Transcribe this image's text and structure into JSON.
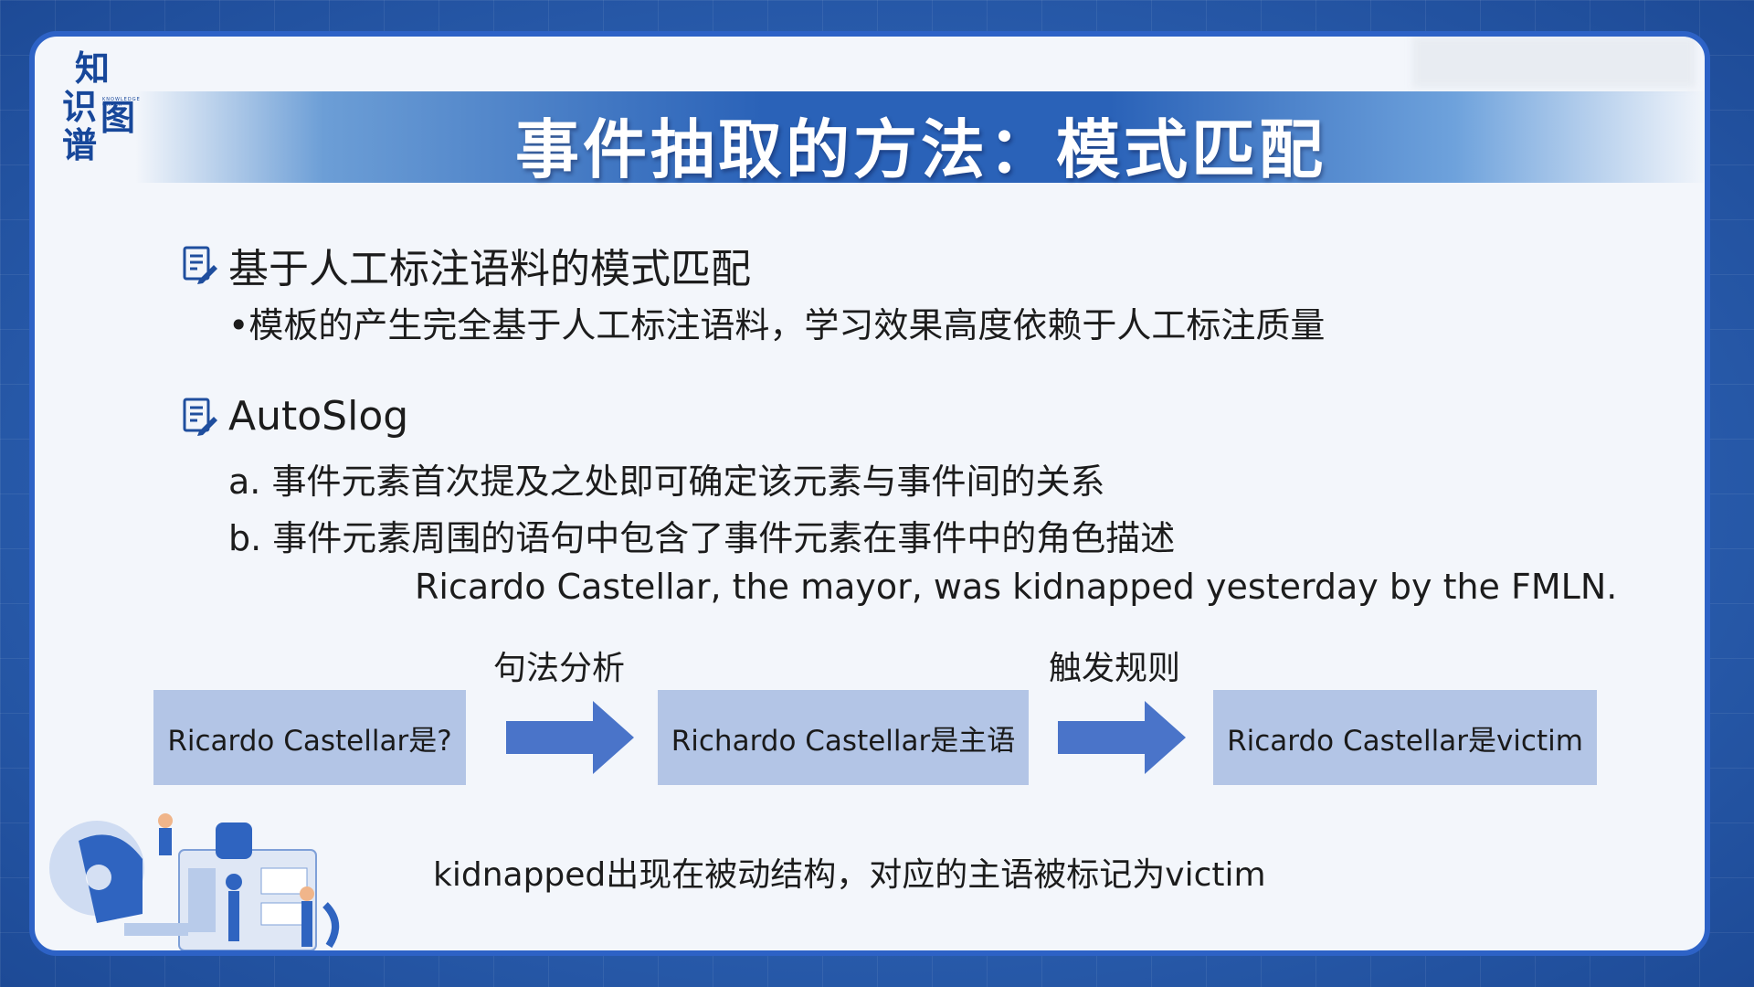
{
  "logo": {
    "chars": [
      "知",
      "识",
      "图",
      "谱"
    ],
    "tiny_text": "KNOWLEDGE GRAPH"
  },
  "title": "事件抽取的方法：模式匹配",
  "section1": {
    "heading": "基于人工标注语料的模式匹配",
    "bullet": "•模板的产生完全基于人工标注语料，学习效果高度依赖于人工标注质量"
  },
  "section2": {
    "heading": "AutoSlog",
    "item_a": "a. 事件元素首次提及之处即可确定该元素与事件间的关系",
    "item_b": "b. 事件元素周围的语句中包含了事件元素在事件中的角色描述",
    "example_sentence": "Ricardo Castellar, the mayor, was kidnapped yesterday by the FMLN."
  },
  "flow": {
    "label1": "句法分析",
    "label2": "触发规则",
    "box1": "Ricardo Castellar是?",
    "box2": "Richardo Castellar是主语",
    "box3": "Ricardo Castellar是victim",
    "arrow_color": "#4a74c9",
    "box_color": "#b3c5e6"
  },
  "conclusion": "kidnapped出现在被动结构，对应的主语被标记为victim",
  "colors": {
    "accent": "#2d62c6",
    "title_band": "#2a62b8",
    "slide_bg": "#f3f6fb"
  }
}
